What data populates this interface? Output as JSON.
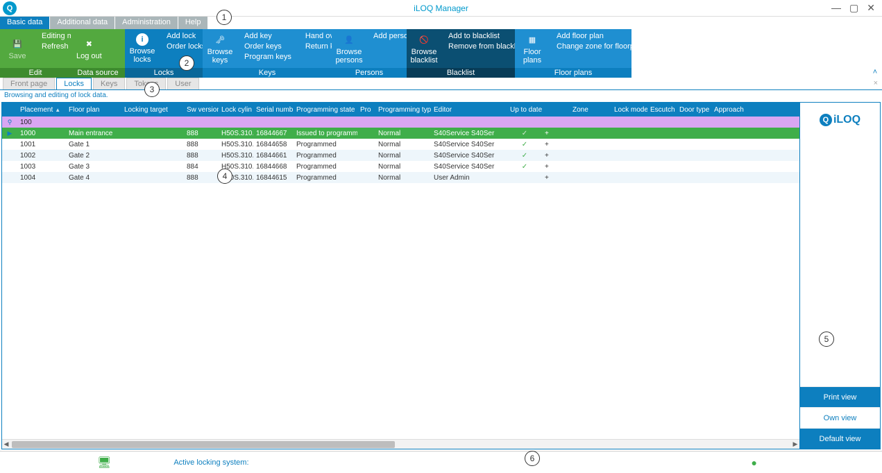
{
  "title": "iLOQ Manager",
  "menu_tabs": [
    "Basic data",
    "Additional data",
    "Administration",
    "Help"
  ],
  "menu_active_index": 0,
  "ribbon": {
    "edit": {
      "save": "Save",
      "editing": "Editing mode",
      "refresh": "Refresh",
      "caption": "Edit"
    },
    "data": {
      "logout": "Log out",
      "caption": "Data source"
    },
    "locks": {
      "browse": "Browse locks",
      "add": "Add lock",
      "order": "Order locks",
      "caption": "Locks"
    },
    "keys": {
      "browse": "Browse keys",
      "add": "Add key",
      "order": "Order keys",
      "program": "Program keys",
      "hand": "Hand over key",
      "return": "Return key",
      "caption": "Keys"
    },
    "persons": {
      "browse": "Browse persons",
      "add": "Add person",
      "caption": "Persons"
    },
    "blacklist": {
      "browse": "Browse blacklist",
      "add": "Add to blacklist",
      "remove": "Remove from blacklist",
      "caption": "Blacklist"
    },
    "floor": {
      "browse": "Floor plans",
      "add": "Add floor plan",
      "change": "Change zone for floorplan",
      "caption": "Floor plans"
    }
  },
  "subtabs": [
    "Front page",
    "Locks",
    "Keys",
    "Tokens",
    "User"
  ],
  "subtab_active_index": 1,
  "desc": "Browsing and editing of lock data.",
  "columns": {
    "placement": "Placement",
    "floorplan": "Floor plan",
    "target": "Locking target",
    "sw": "Sw version",
    "cyl": "Lock cylin",
    "serial": "Serial numb",
    "progstate": "Programming state",
    "pro": "Pro",
    "progtype": "Programming type",
    "editor": "Editor",
    "uptodate": "Up to date blacklist",
    "zone": "Zone",
    "lockmode": "Lock mode",
    "escutch": "Escutch",
    "doortype": "Door type",
    "approach": "Approach"
  },
  "group_row": {
    "placement": "100"
  },
  "rows": [
    {
      "placement": "1000",
      "floorplan": "Main entrance",
      "target": "",
      "sw": "888",
      "cyl": "H50S.310.",
      "serial": "16844667",
      "progstate": "Issued to programmi",
      "progtype": "Normal",
      "editor": "S40Service S40Ser",
      "uptodate": "✓",
      "blplus": "+",
      "selected": true
    },
    {
      "placement": "1001",
      "floorplan": "Gate 1",
      "target": "",
      "sw": "888",
      "cyl": "H50S.310.",
      "serial": "16844658",
      "progstate": "Programmed",
      "progtype": "Normal",
      "editor": "S40Service S40Ser",
      "uptodate": "✓",
      "blplus": "+"
    },
    {
      "placement": "1002",
      "floorplan": "Gate 2",
      "target": "",
      "sw": "888",
      "cyl": "H50S.310.",
      "serial": "16844661",
      "progstate": "Programmed",
      "progtype": "Normal",
      "editor": "S40Service S40Ser",
      "uptodate": "✓",
      "blplus": "+",
      "alt": true
    },
    {
      "placement": "1003",
      "floorplan": "Gate 3",
      "target": "",
      "sw": "884",
      "cyl": "H50S.310.",
      "serial": "16844668",
      "progstate": "Programmed",
      "progtype": "Normal",
      "editor": "S40Service S40Ser",
      "uptodate": "✓",
      "blplus": "+"
    },
    {
      "placement": "1004",
      "floorplan": "Gate 4",
      "target": "",
      "sw": "888",
      "cyl": "H50S.310.",
      "serial": "16844615",
      "progstate": "Programmed",
      "progtype": "Normal",
      "editor": "User Admin",
      "uptodate": "",
      "blplus": "+",
      "alt": true
    }
  ],
  "side": {
    "brand": "iLOQ",
    "print": "Print view",
    "own": "Own view",
    "default": "Default view"
  },
  "status": {
    "active": "Active locking system:"
  },
  "callouts": [
    "1",
    "2",
    "3",
    "4",
    "5",
    "6"
  ]
}
